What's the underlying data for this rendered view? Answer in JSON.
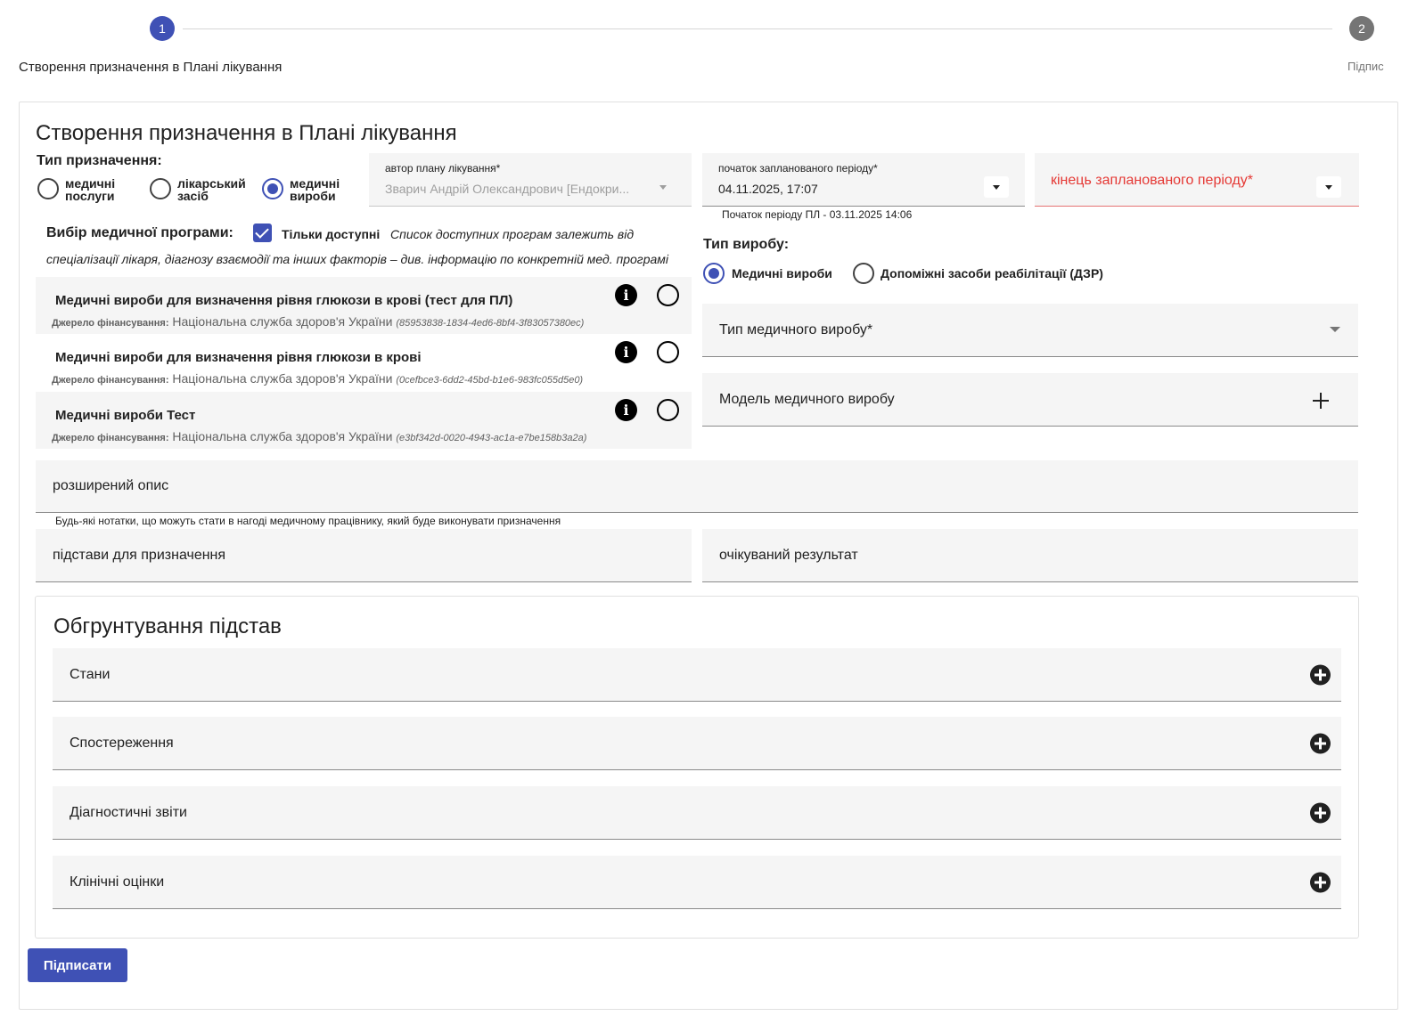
{
  "stepper": {
    "step1_number": "1",
    "step1_label": "Створення призначення в Плані лікування",
    "step2_number": "2",
    "step2_label": "Підпис"
  },
  "form": {
    "title": "Створення призначення в Плані лікування",
    "type_label": "Тип призначення:",
    "type_options": [
      {
        "line1": "медичні",
        "line2": "послуги",
        "checked": false
      },
      {
        "line1": "лікарський",
        "line2": "засіб",
        "checked": false
      },
      {
        "line1": "медичні",
        "line2": "вироби",
        "checked": true
      }
    ],
    "author": {
      "label": "автор плану лікування*",
      "value": "Зварич Андрій Олександрович [Ендокри..."
    },
    "period_start": {
      "label": "початок запланованого періоду*",
      "value": "04.11.2025, 17:07",
      "hint": "Початок періоду ПЛ - 03.11.2025 14:06"
    },
    "period_end": {
      "label": "кінець запланованого періоду*"
    },
    "program": {
      "title": "Вибір медичної програми:",
      "only_available_label": "Тільки доступні",
      "only_available_checked": true,
      "note_line1": "Список доступних програм залежить від",
      "note_line2": "спеціалізації лікаря, діагнозу взаємодії та інших факторів – див. інформацію по конкретній мед. програмі",
      "source_label": "Джерело фінансування:",
      "items": [
        {
          "name": "Медичні вироби для визначення рівня глюкози в крові (тест для ПЛ)",
          "source": "Національна служба здоров'я України",
          "id": "(85953838-1834-4ed6-8bf4-3f83057380ec)"
        },
        {
          "name": "Медичні вироби для визначення рівня глюкози в крові",
          "source": "Національна служба здоров'я України",
          "id": "(0cefbce3-6dd2-45bd-b1e6-983fc055d5e0)"
        },
        {
          "name": "Медичні вироби Тест",
          "source": "Національна служба здоров'я України",
          "id": "(e3bf342d-0020-4943-ac1a-e7be158b3a2a)"
        }
      ]
    },
    "product_type": {
      "label": "Тип виробу:",
      "options": [
        {
          "label": "Медичні вироби",
          "checked": true
        },
        {
          "label": "Допоміжні засоби реабілітації (ДЗР)",
          "checked": false
        }
      ]
    },
    "medical_product_type_label": "Тип медичного виробу*",
    "medical_product_model_label": "Модель медичного виробу",
    "extended_description": {
      "label": "розширений опис",
      "hint": "Будь-які нотатки, що можуть стати в нагоді медичному працівнику, який буде виконувати призначення"
    },
    "reason_label": "підстави для призначення",
    "expected_result_label": "очікуваний результат",
    "justification": {
      "title": "Обгрунтування підстав",
      "items": [
        "Стани",
        "Спостереження",
        "Діагностичні звіти",
        "Клінічні оцінки"
      ]
    },
    "sign_button": "Підписати"
  },
  "colors": {
    "accent": "#3f51b5",
    "error": "#e53935",
    "field_bg": "#f5f5f5"
  }
}
